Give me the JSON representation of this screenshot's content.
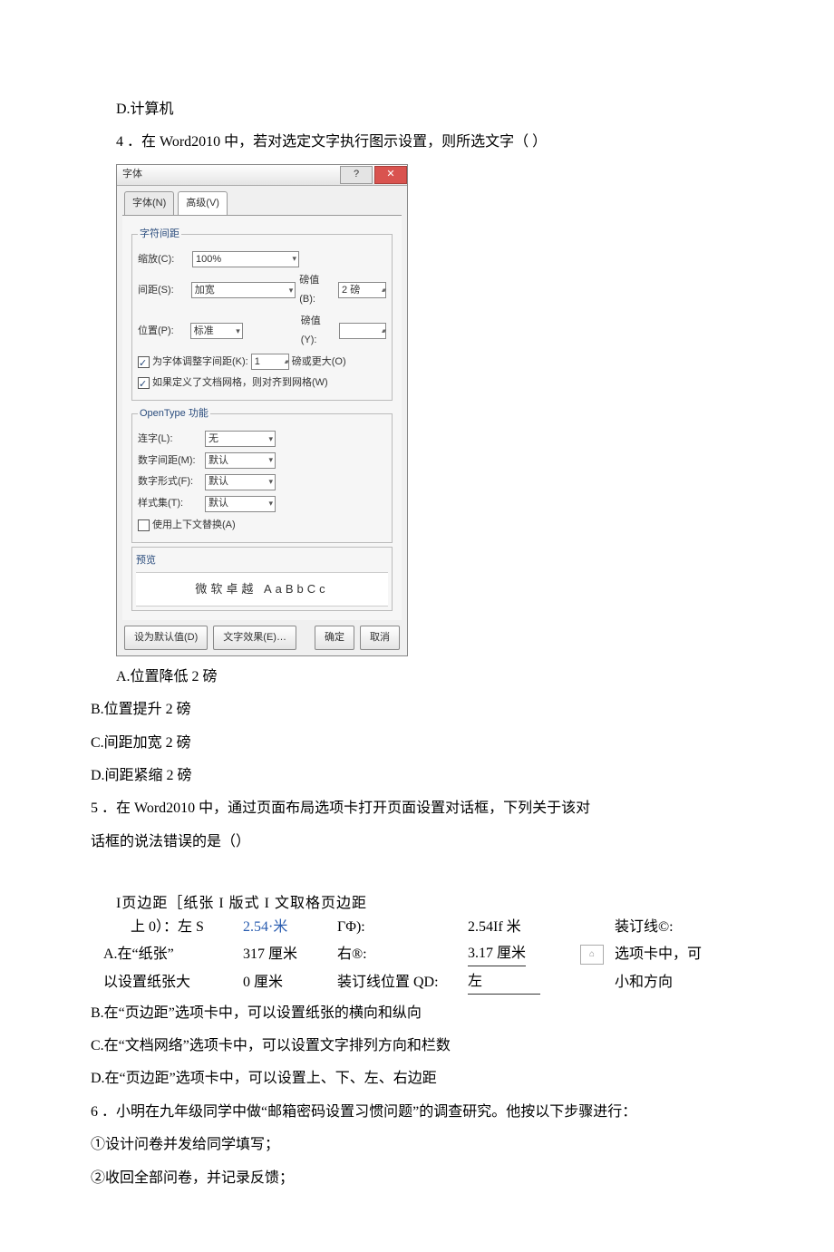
{
  "q3_opt_d": "D.计算机",
  "q4_stem": "4 ．在 Word2010 中，若对选定文字执行图示设置，则所选文字（            ）",
  "dlg": {
    "title": "字体",
    "tab1": "字体(N)",
    "tab2": "高级(V)",
    "grp1_legend": "字符间距",
    "scale_lbl": "缩放(C):",
    "scale_val": "100%",
    "spacing_lbl": "间距(S):",
    "spacing_val": "加宽",
    "spacing_pt_lbl": "磅值(B):",
    "spacing_pt_val": "2 磅",
    "pos_lbl": "位置(P):",
    "pos_val": "标准",
    "pos_pt_lbl": "磅值(Y):",
    "pos_pt_val": "",
    "kern_chk": "为字体调整字间距(K):",
    "kern_val": "1",
    "kern_unit": "磅或更大(O)",
    "grid_chk": "如果定义了文档网格，则对齐到网格(W)",
    "grp2_legend": "OpenType 功能",
    "lig_lbl": "连字(L):",
    "lig_val": "无",
    "numsp_lbl": "数字间距(M):",
    "numsp_val": "默认",
    "numform_lbl": "数字形式(F):",
    "numform_val": "默认",
    "styleset_lbl": "样式集(T):",
    "styleset_val": "默认",
    "context_chk": "使用上下文替换(A)",
    "preview_lbl": "预览",
    "preview_txt": "微软卓越  AaBbCc",
    "default_btn": "设为默认值(D)",
    "effects_btn": "文字效果(E)…",
    "ok_btn": "确定",
    "cancel_btn": "取消"
  },
  "q4_opts": {
    "a": "A.位置降低 2 磅",
    "b": "B.位置提升 2 磅",
    "c": "C.间距加宽 2 磅",
    "d": "D.间距紧缩 2 磅"
  },
  "q5_stem1": "5 ．在 Word2010 中，通过页面布局选项卡打开页面设置对话框，下列关于该对",
  "q5_stem2": "话框的说法错误的是（）",
  "q5": {
    "tabs": "I页边距［纸张 I 版式 I 文取格页边距",
    "r1c1": "上 0）：左 S",
    "r1c2": "2.54·米",
    "r1c3": "ΓΦ):",
    "r1c4": "2.54If 米",
    "r1c6": "装订线©:",
    "r2c0": "A.在“纸张”",
    "r2c2": "317 厘米",
    "r2c3": "右®:",
    "r2c4": "3.17 厘米",
    "r2c6": "选项卡中，可",
    "r3c0": "以设置纸张大",
    "r3c2": "0 厘米",
    "r3c3": "装订线位置 QD:",
    "r3c4": "左",
    "r3c6": "小和方向"
  },
  "q5_opts": {
    "b": "B.在“页边距”选项卡中，可以设置纸张的横向和纵向",
    "c": "C.在“文档网络”选项卡中，可以设置文字排列方向和栏数",
    "d": "D.在“页边距”选项卡中，可以设置上、下、左、右边距"
  },
  "q6_stem": "6 ．小明在九年级同学中做“邮箱密码设置习惯问题”的调查研究。他按以下步骤进行：",
  "q6_s1": "①设计问卷并发给同学填写；",
  "q6_s2": "②收回全部问卷，并记录反馈；"
}
